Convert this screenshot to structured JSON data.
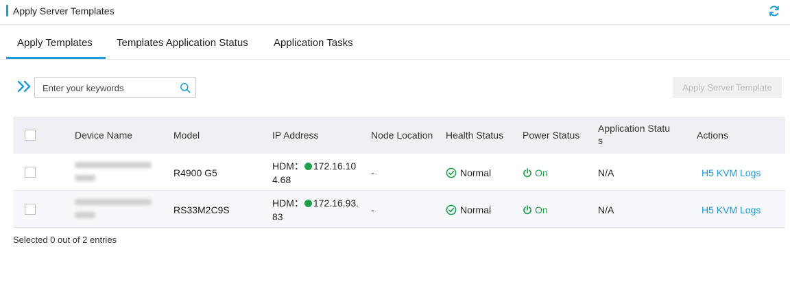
{
  "header": {
    "title": "Apply Server Templates",
    "refresh_icon": "refresh-icon"
  },
  "tabs": [
    {
      "label": "Apply Templates",
      "active": true
    },
    {
      "label": "Templates Application Status",
      "active": false
    },
    {
      "label": "Application Tasks",
      "active": false
    }
  ],
  "toolbar": {
    "search_placeholder": "Enter your keywords",
    "apply_button": "Apply Server Template",
    "accent": "#1a9bd7"
  },
  "table": {
    "columns": [
      "Device Name",
      "Model",
      "IP Address",
      "Node Location",
      "Health Status",
      "Power Status",
      "Application Status",
      "Actions"
    ],
    "col_app_status_line1": "Application Statu",
    "col_app_status_line2": "s",
    "rows": [
      {
        "device_name_line1": "",
        "device_name_line2": "",
        "model": "R4900 G5",
        "ip_prefix": "HDM：",
        "ip_line1": "172.16.10",
        "ip_line2": "4.68",
        "node_location": "-",
        "health": "Normal",
        "power": "On",
        "application_status": "N/A",
        "action_kvm": "H5 KVM",
        "action_logs": "Logs"
      },
      {
        "device_name_line1": "",
        "device_name_line2": "",
        "model": "RS33M2C9S",
        "ip_prefix": "HDM：",
        "ip_line1": "172.16.93.",
        "ip_line2": "83",
        "node_location": "-",
        "health": "Normal",
        "power": "On",
        "application_status": "N/A",
        "action_kvm": "H5 KVM",
        "action_logs": "Logs"
      }
    ]
  },
  "footer": {
    "selection_text": "Selected 0 out of 2 entries"
  },
  "colors": {
    "accent": "#1a9bd7",
    "success": "#1ea14a"
  }
}
